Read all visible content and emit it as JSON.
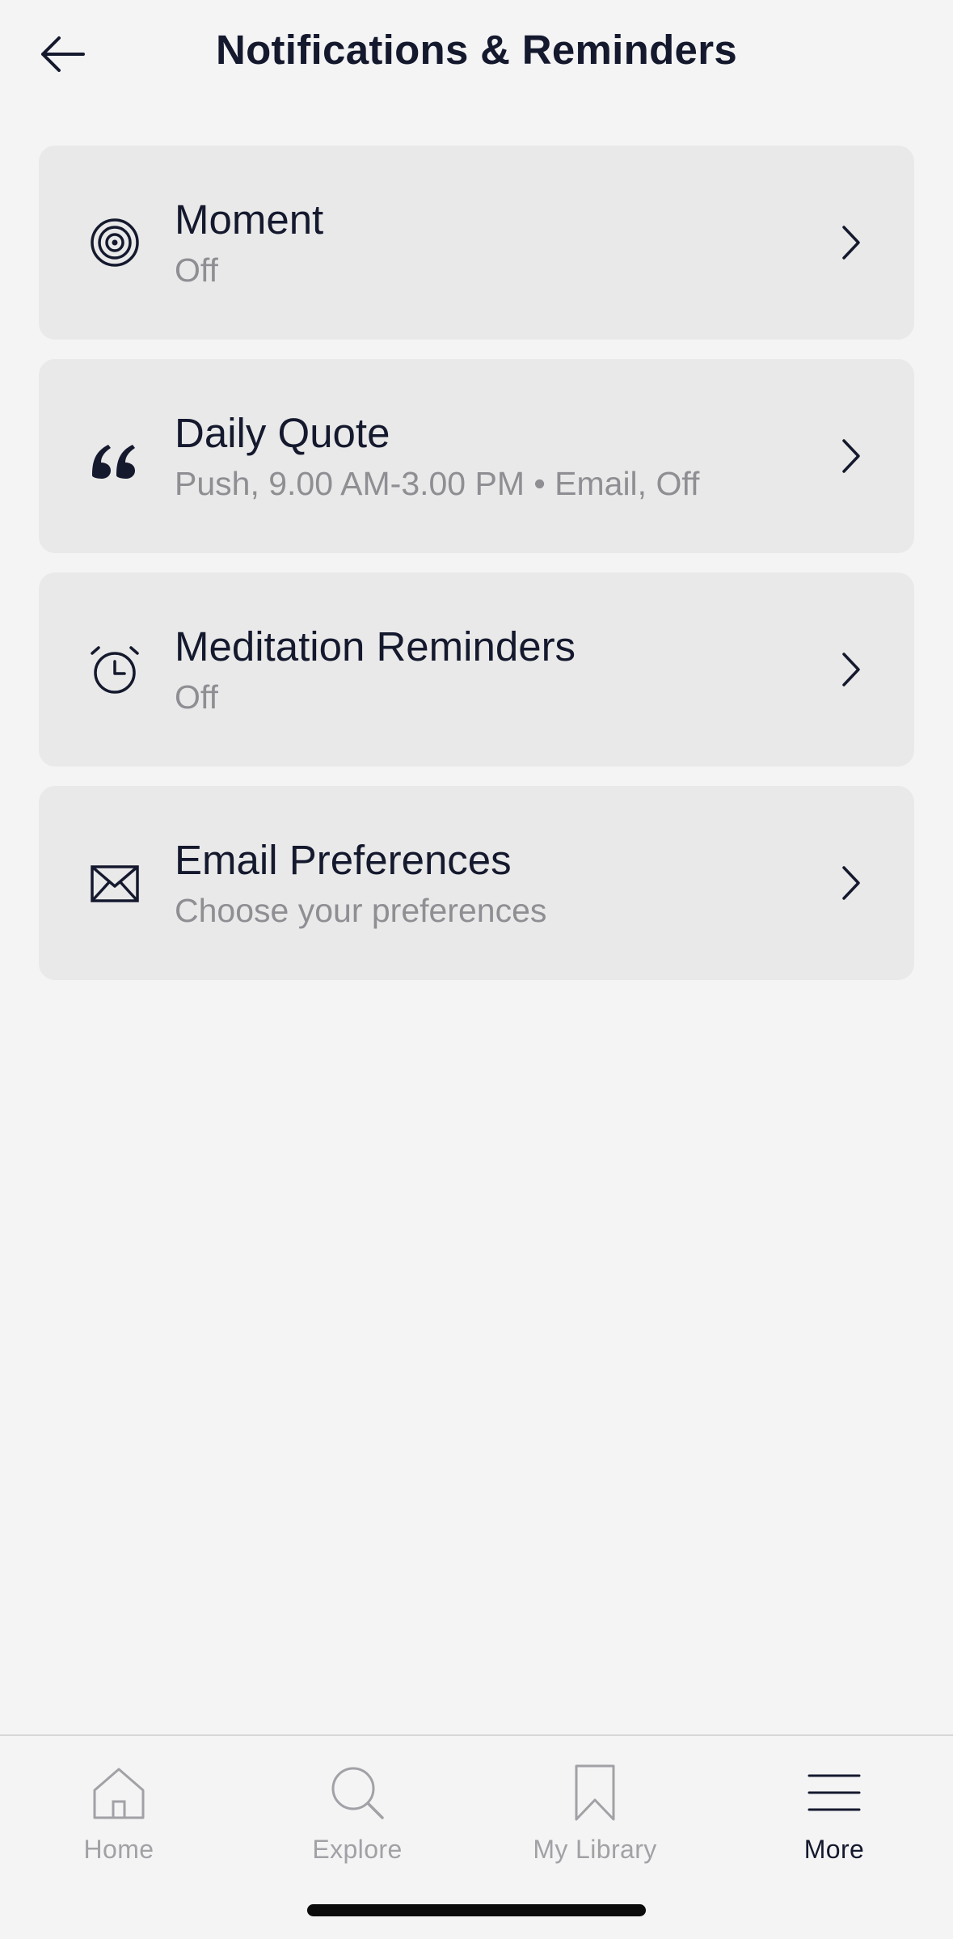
{
  "header": {
    "title": "Notifications & Reminders",
    "back_icon": "arrow-left-icon"
  },
  "colors": {
    "background": "#f4f4f4",
    "card": "#e9e9e9",
    "primary_text": "#15192e",
    "secondary_text": "#8e8e93",
    "inactive_tab": "#a1a1a6"
  },
  "settings": [
    {
      "icon": "target-icon",
      "title": "Moment",
      "subtitle": "Off"
    },
    {
      "icon": "quote-icon",
      "title": "Daily Quote",
      "subtitle": "Push, 9.00 AM-3.00 PM • Email, Off"
    },
    {
      "icon": "alarm-clock-icon",
      "title": "Meditation Reminders",
      "subtitle": "Off"
    },
    {
      "icon": "envelope-icon",
      "title": "Email Preferences",
      "subtitle": "Choose your preferences"
    }
  ],
  "tabbar": {
    "tabs": [
      {
        "label": "Home",
        "icon": "home-icon",
        "active": false
      },
      {
        "label": "Explore",
        "icon": "search-icon",
        "active": false
      },
      {
        "label": "My Library",
        "icon": "bookmark-icon",
        "active": false
      },
      {
        "label": "More",
        "icon": "menu-icon",
        "active": true
      }
    ]
  }
}
